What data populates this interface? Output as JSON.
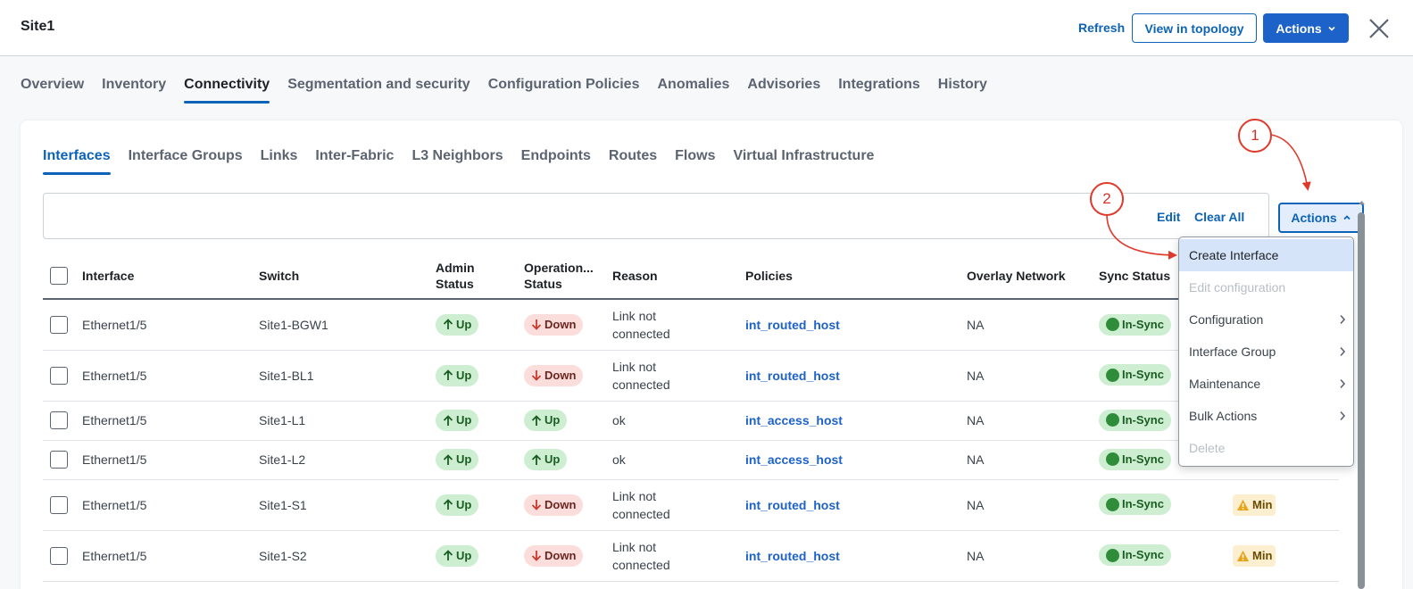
{
  "header": {
    "title": "Site1",
    "refresh_label": "Refresh",
    "topology_label": "View in topology",
    "actions_label": "Actions"
  },
  "main_tabs": [
    "Overview",
    "Inventory",
    "Connectivity",
    "Segmentation and security",
    "Configuration Policies",
    "Anomalies",
    "Advisories",
    "Integrations",
    "History"
  ],
  "main_tab_active": "Connectivity",
  "sub_tabs": [
    "Interfaces",
    "Interface Groups",
    "Links",
    "Inter-Fabric",
    "L3 Neighbors",
    "Endpoints",
    "Routes",
    "Flows",
    "Virtual Infrastructure"
  ],
  "sub_tab_active": "Interfaces",
  "filter": {
    "edit_label": "Edit",
    "clear_label": "Clear All",
    "actions_label": "Actions"
  },
  "table": {
    "columns": {
      "interface": "Interface",
      "switch": "Switch",
      "admin_1": "Admin",
      "admin_2": "Status",
      "oper_1": "Operation...",
      "oper_2": "Status",
      "reason": "Reason",
      "policies": "Policies",
      "overlay": "Overlay Network",
      "sync": "Sync Status"
    },
    "rows": [
      {
        "interface": "Ethernet1/5",
        "switch": "Site1-BGW1",
        "admin": "Up",
        "oper": "Down",
        "reason_1": "Link not",
        "reason_2": "connected",
        "policy": "int_routed_host",
        "overlay": "NA",
        "sync": "In-Sync",
        "anomaly": ""
      },
      {
        "interface": "Ethernet1/5",
        "switch": "Site1-BL1",
        "admin": "Up",
        "oper": "Down",
        "reason_1": "Link not",
        "reason_2": "connected",
        "policy": "int_routed_host",
        "overlay": "NA",
        "sync": "In-Sync",
        "anomaly": ""
      },
      {
        "interface": "Ethernet1/5",
        "switch": "Site1-L1",
        "admin": "Up",
        "oper": "Up",
        "reason_1": "ok",
        "reason_2": "",
        "policy": "int_access_host",
        "overlay": "NA",
        "sync": "In-Sync",
        "anomaly": ""
      },
      {
        "interface": "Ethernet1/5",
        "switch": "Site1-L2",
        "admin": "Up",
        "oper": "Up",
        "reason_1": "ok",
        "reason_2": "",
        "policy": "int_access_host",
        "overlay": "NA",
        "sync": "In-Sync",
        "anomaly": ""
      },
      {
        "interface": "Ethernet1/5",
        "switch": "Site1-S1",
        "admin": "Up",
        "oper": "Down",
        "reason_1": "Link not",
        "reason_2": "connected",
        "policy": "int_routed_host",
        "overlay": "NA",
        "sync": "In-Sync",
        "anomaly": "Min"
      },
      {
        "interface": "Ethernet1/5",
        "switch": "Site1-S2",
        "admin": "Up",
        "oper": "Down",
        "reason_1": "Link not",
        "reason_2": "connected",
        "policy": "int_routed_host",
        "overlay": "NA",
        "sync": "In-Sync",
        "anomaly": "Min"
      }
    ]
  },
  "dropdown": {
    "items": [
      {
        "label": "Create Interface",
        "state": "highlighted",
        "submenu": false
      },
      {
        "label": "Edit configuration",
        "state": "disabled",
        "submenu": false
      },
      {
        "label": "Configuration",
        "state": "enabled",
        "submenu": true
      },
      {
        "label": "Interface Group",
        "state": "enabled",
        "submenu": true
      },
      {
        "label": "Maintenance",
        "state": "enabled",
        "submenu": true
      },
      {
        "label": "Bulk Actions",
        "state": "enabled",
        "submenu": true
      },
      {
        "label": "Delete",
        "state": "disabled",
        "submenu": false
      }
    ]
  },
  "callouts": {
    "first": "1",
    "second": "2"
  },
  "colors": {
    "accent": "#0d63b8",
    "primary_button": "#1d62c9",
    "status_up": "#cdeed0",
    "status_down": "#fbdedb",
    "callout": "#e0392b"
  }
}
